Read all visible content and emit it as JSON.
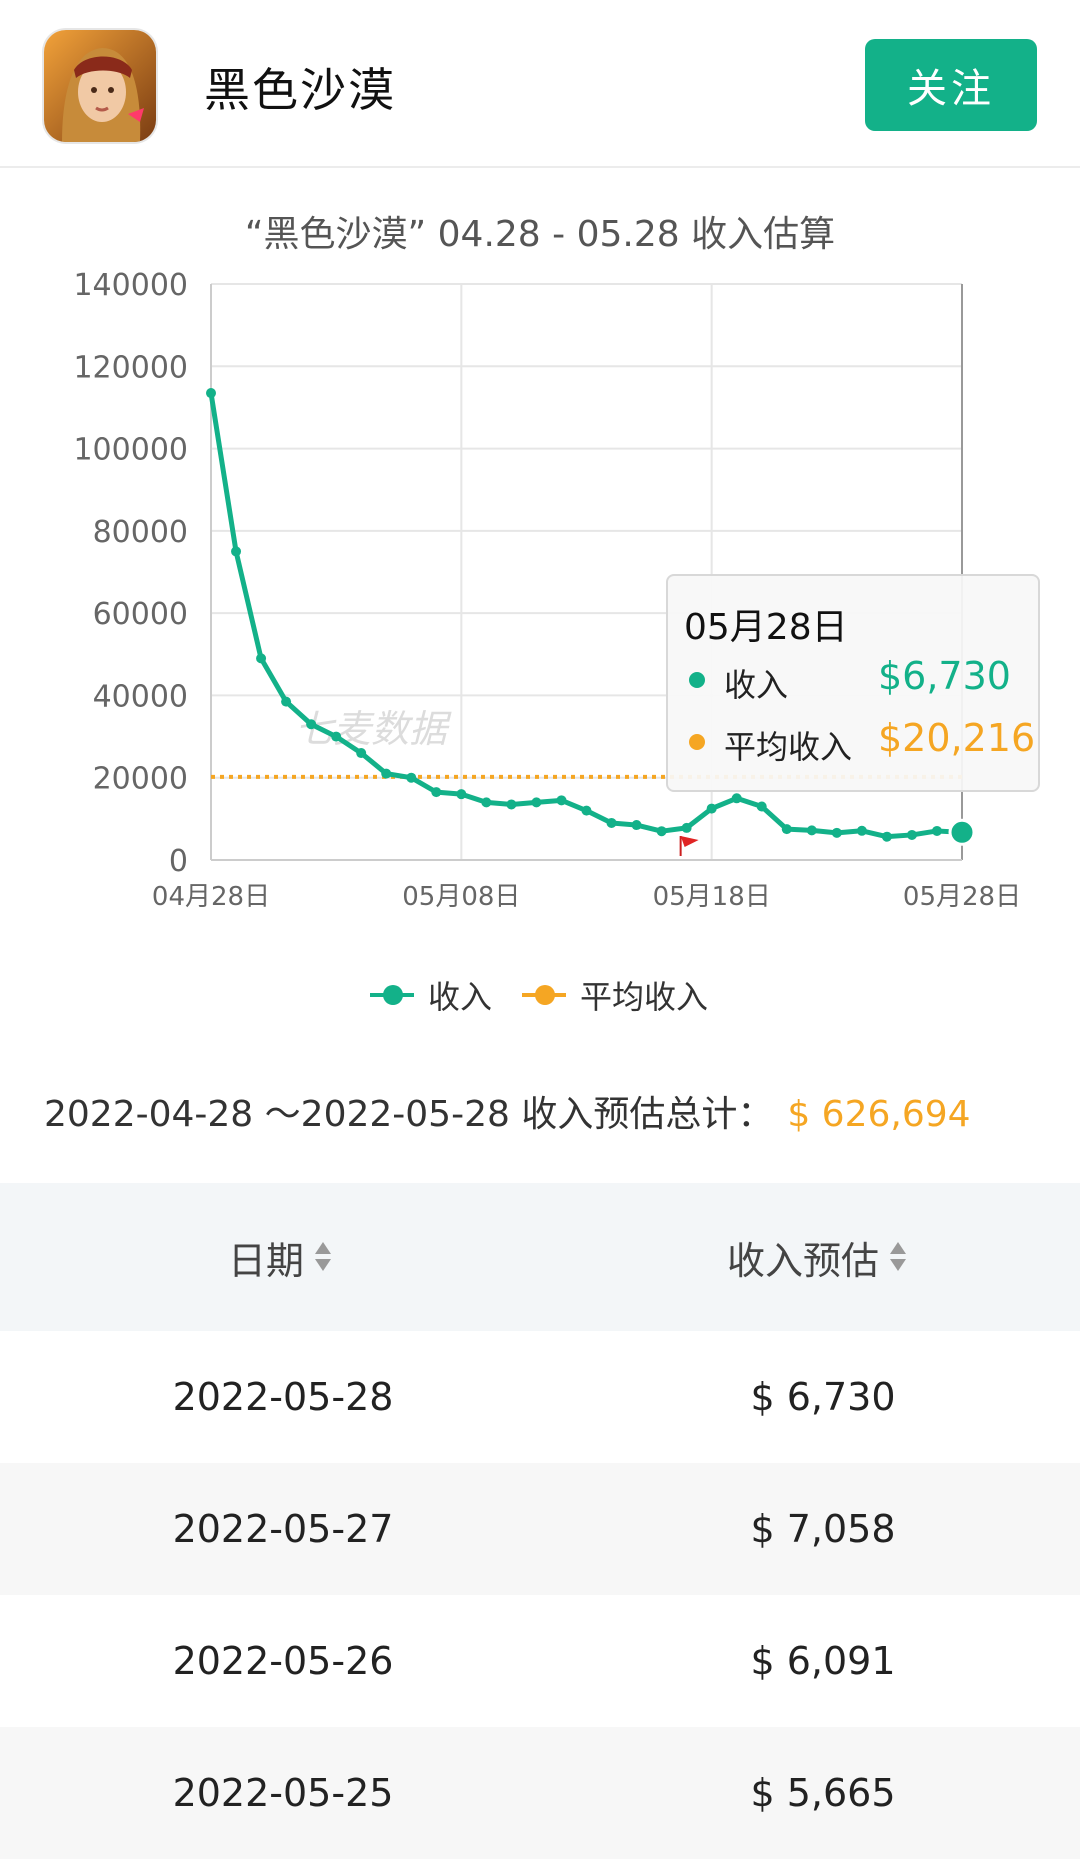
{
  "header": {
    "app_icon": "game-character-icon",
    "app_title": "黑色沙漠",
    "follow_label": "关注"
  },
  "colors": {
    "accent": "#13b189",
    "average": "#f5a623",
    "watermark": "#d8d8d8"
  },
  "chart_data": {
    "type": "line",
    "title": "“黑色沙漠” 04.28 - 05.28 收入估算",
    "watermark": "七麦数据",
    "ylim": [
      0,
      140000
    ],
    "y_ticks": [
      "140000",
      "120000",
      "100000",
      "80000",
      "60000",
      "40000",
      "20000",
      "0"
    ],
    "x_ticks": [
      "04月28日",
      "05月08日",
      "05月18日",
      "05月28日"
    ],
    "grid": true,
    "legend_position": "bottom-center",
    "x": [
      "04-28",
      "04-29",
      "04-30",
      "05-01",
      "05-02",
      "05-03",
      "05-04",
      "05-05",
      "05-06",
      "05-07",
      "05-08",
      "05-09",
      "05-10",
      "05-11",
      "05-12",
      "05-13",
      "05-14",
      "05-15",
      "05-16",
      "05-17",
      "05-18",
      "05-19",
      "05-20",
      "05-21",
      "05-22",
      "05-23",
      "05-24",
      "05-25",
      "05-26",
      "05-27",
      "05-28"
    ],
    "series": [
      {
        "name": "收入",
        "color": "#13b189",
        "values": [
          113500,
          75000,
          49000,
          38500,
          33000,
          30000,
          26000,
          21000,
          20000,
          16500,
          16000,
          14000,
          13500,
          14000,
          14500,
          12000,
          9000,
          8500,
          7000,
          7800,
          12500,
          15000,
          13000,
          7500,
          7200,
          6600,
          7100,
          5665,
          6091,
          7058,
          6730
        ]
      },
      {
        "name": "平均收入",
        "color": "#f5a623",
        "style": "dotted",
        "constant": 20216
      }
    ],
    "event_marker": {
      "icon": "red-flag-icon",
      "date": "05-17"
    }
  },
  "tooltip": {
    "date": "05月28日",
    "rows": [
      {
        "label": "收入",
        "value": "$6,730"
      },
      {
        "label": "平均收入",
        "value": "$20,216"
      }
    ]
  },
  "summary": {
    "range_label": "2022-04-28 ～2022-05-28 收入预估总计：",
    "total": "$ 626,694"
  },
  "table": {
    "headers": [
      "日期",
      "收入预估"
    ],
    "rows": [
      {
        "date": "2022-05-28",
        "revenue": "$ 6,730"
      },
      {
        "date": "2022-05-27",
        "revenue": "$ 7,058"
      },
      {
        "date": "2022-05-26",
        "revenue": "$ 6,091"
      },
      {
        "date": "2022-05-25",
        "revenue": "$ 5,665"
      }
    ]
  }
}
